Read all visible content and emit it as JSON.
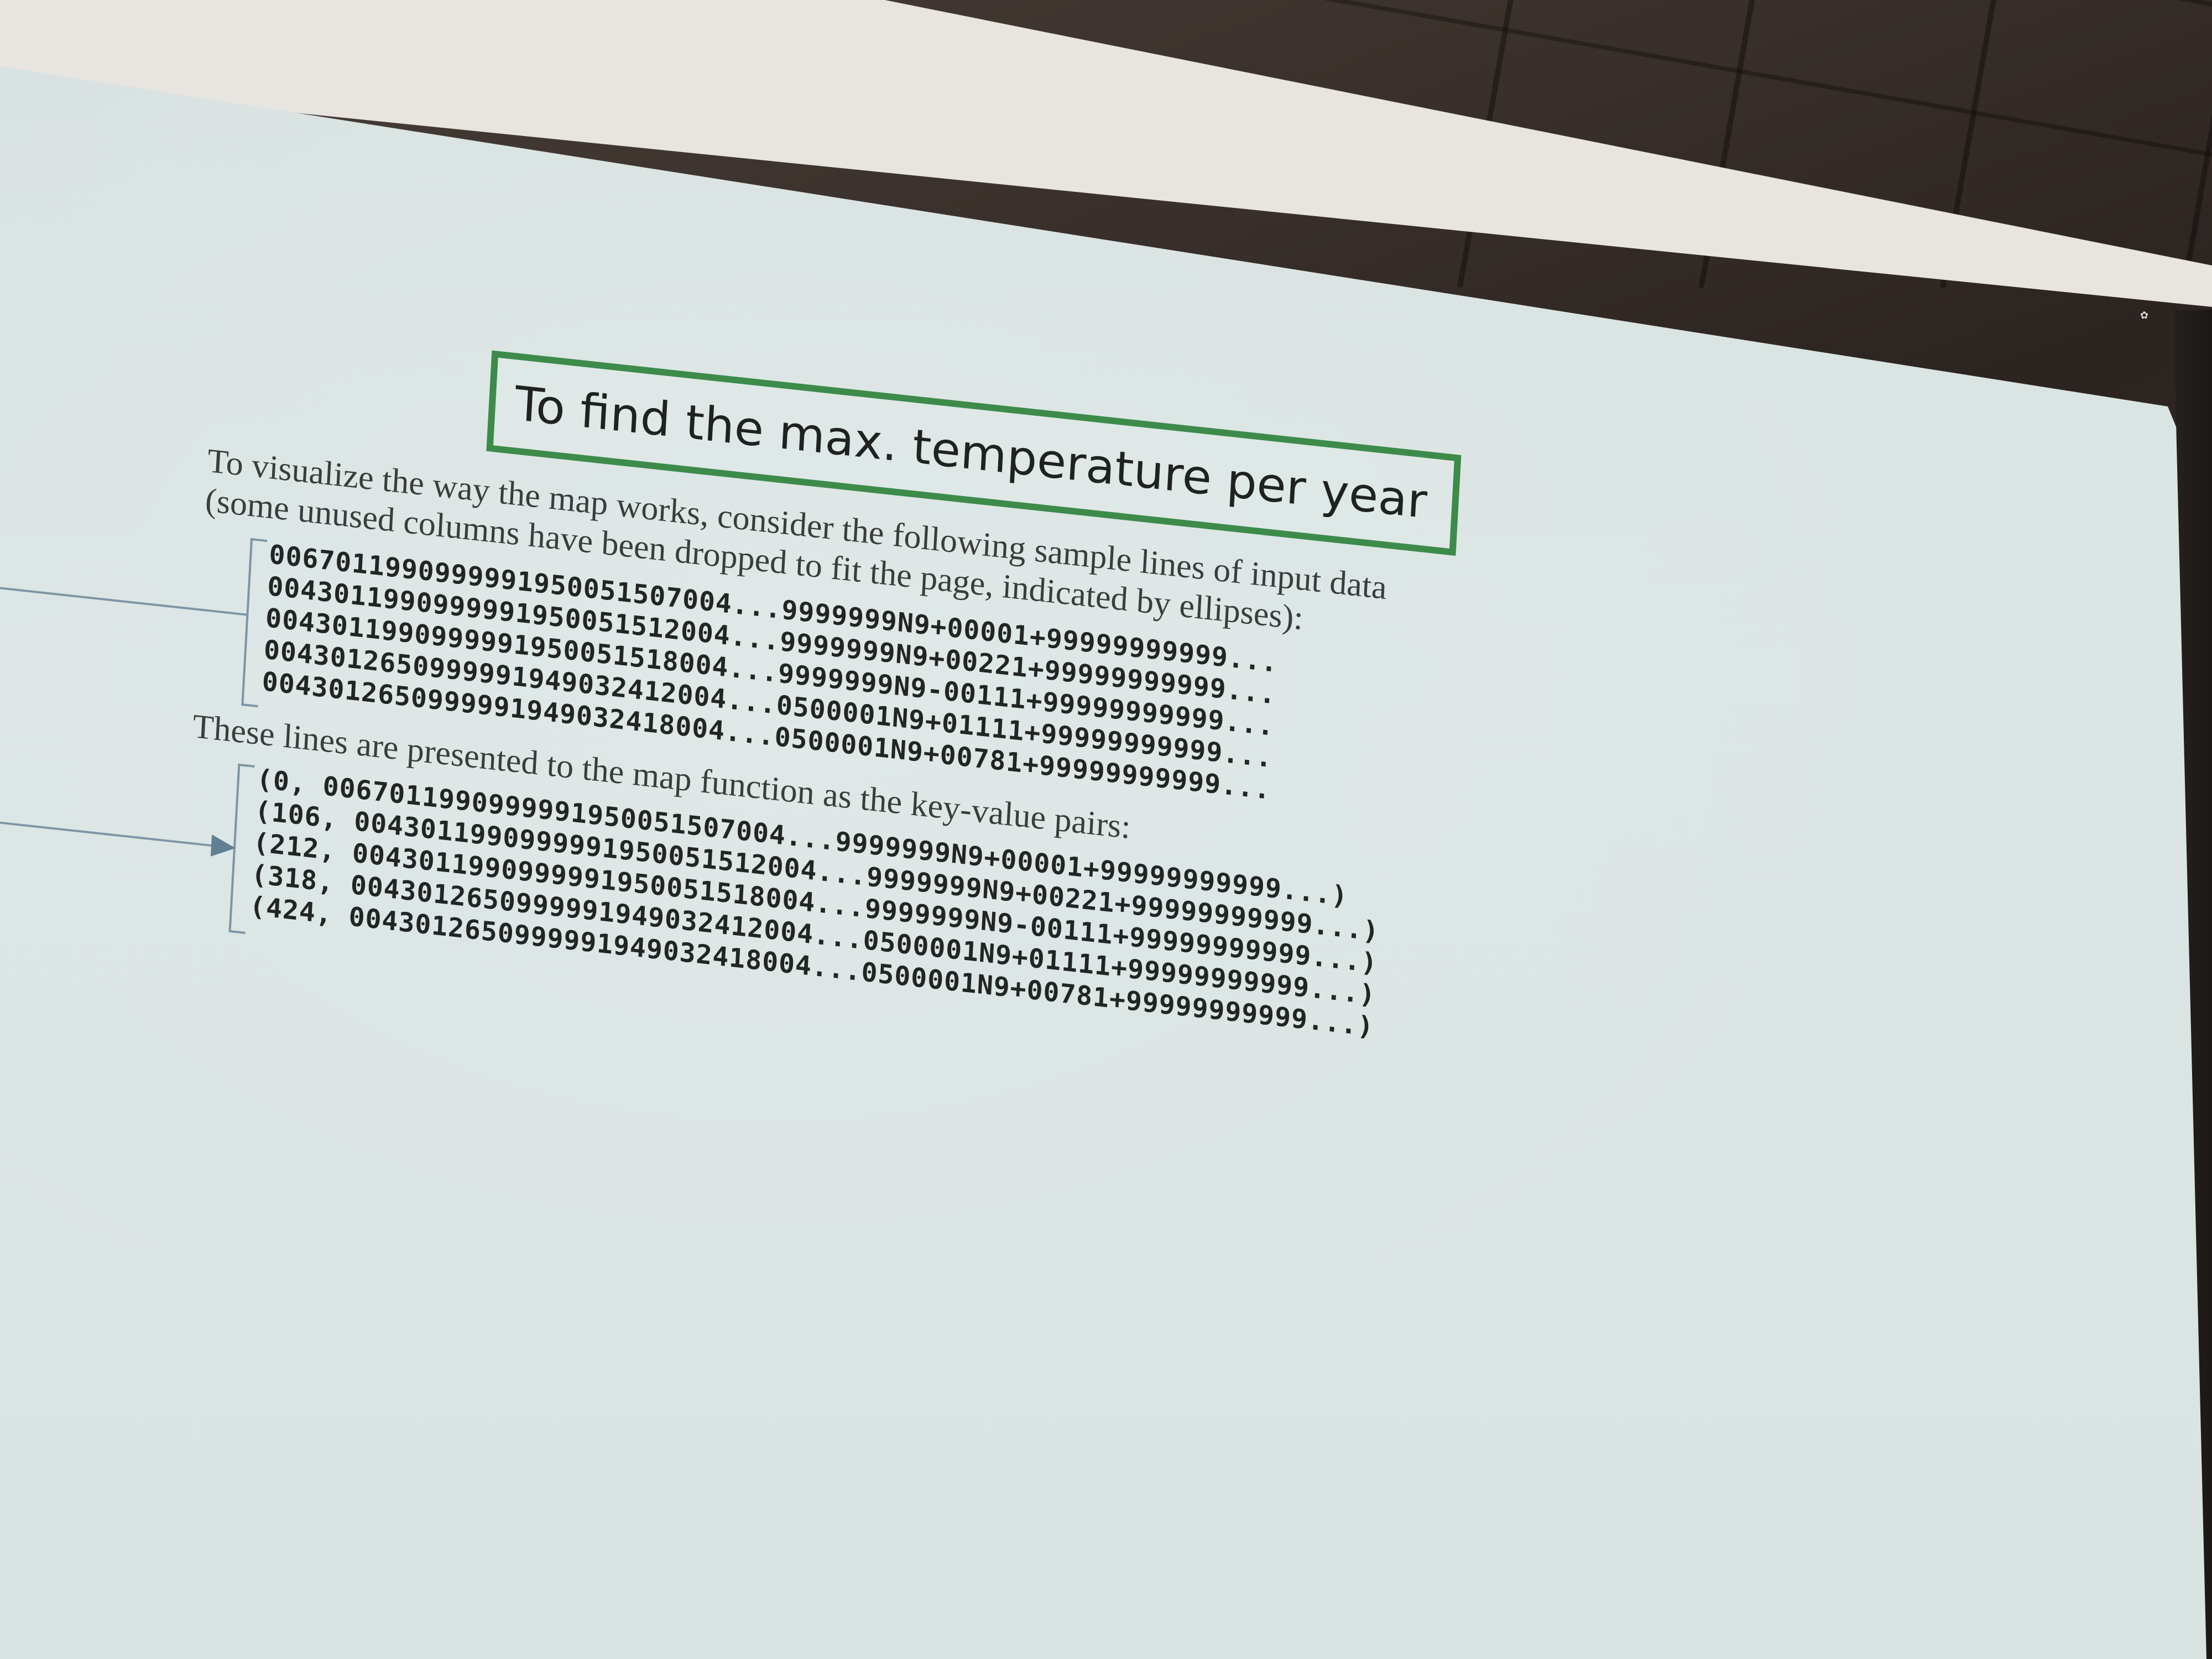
{
  "slide": {
    "title": "To find the max. temperature per year",
    "intro_line_1": "To visualize the way the map works, consider the following sample lines of input data",
    "intro_line_2": "(some unused columns have been dropped to fit the page, indicated by ellipses):",
    "input_lines": [
      "0067011990999991950051507004...9999999N9+00001+99999999999...",
      "0043011990999991950051512004...9999999N9+00221+99999999999...",
      "0043011990999991950051518004...9999999N9-00111+99999999999...",
      "0043012650999991949032412004...0500001N9+01111+99999999999...",
      "0043012650999991949032418004...0500001N9+00781+99999999999..."
    ],
    "transition_text": "These lines are presented to the map function as the key-value pairs:",
    "key_value_pairs": [
      "(0, 0067011990999991950051507004...9999999N9+00001+99999999999...)",
      "(106, 0043011990999991950051512004...9999999N9+00221+99999999999...)",
      "(212, 0043011990999991950051518004...9999999N9-00111+99999999999...)",
      "(318, 0043012650999991949032412004...0500001N9+01111+99999999999...)",
      "(424, 0043012650999991949032418004...0500001N9+00781+99999999999...)"
    ]
  },
  "colors": {
    "title_border": "#3d8b4a",
    "bracket": "#7d96a6",
    "screen": "#d9e3e2"
  },
  "icons": {
    "arrow_left": "arrow-left-icon",
    "arrow_right": "arrow-right-icon"
  }
}
